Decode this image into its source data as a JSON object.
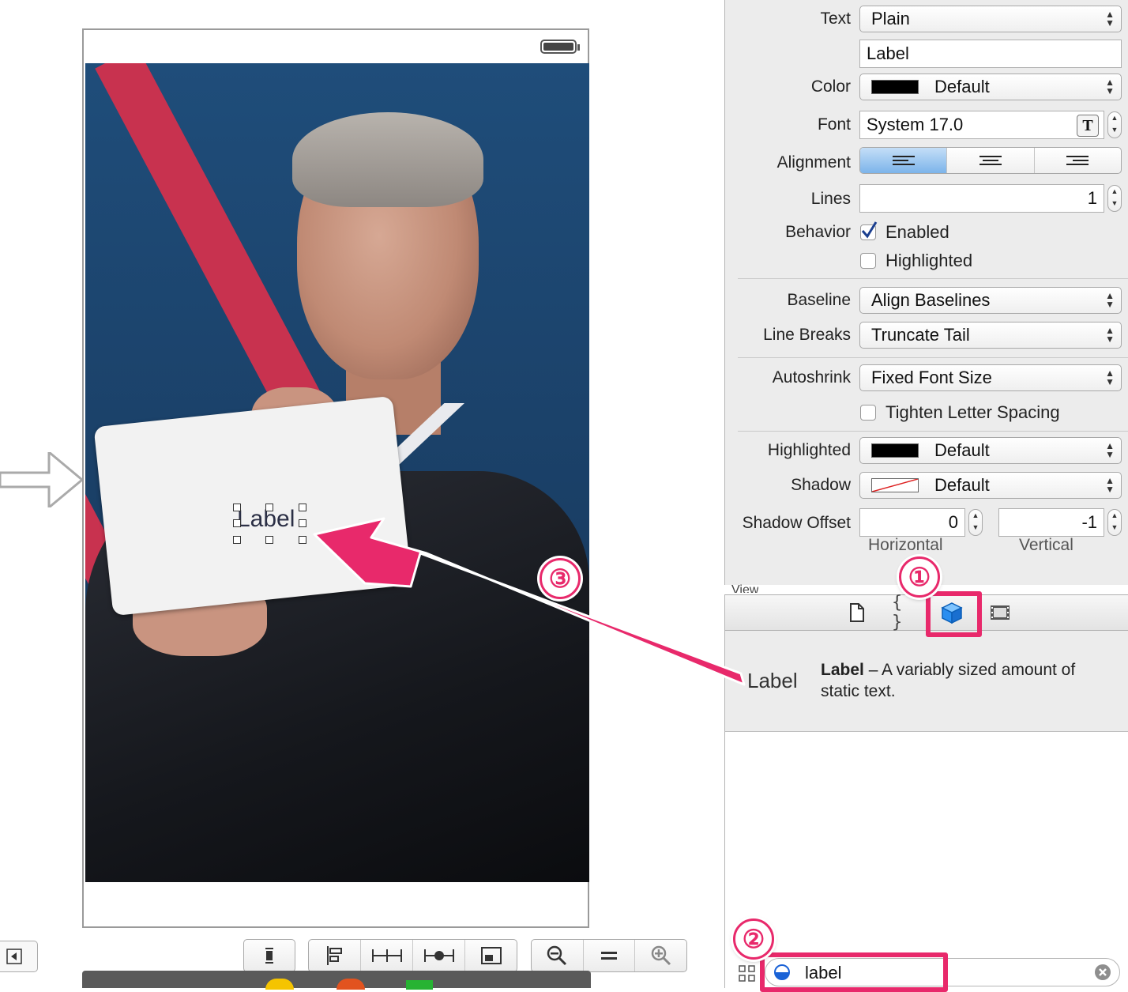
{
  "inspector": {
    "text_label": "Text",
    "text_type": "Plain",
    "text_value": "Label",
    "color_label": "Color",
    "color_value": "Default",
    "font_label": "Font",
    "font_value": "System 17.0",
    "alignment_label": "Alignment",
    "lines_label": "Lines",
    "lines_value": "1",
    "behavior_label": "Behavior",
    "enabled_label": "Enabled",
    "highlighted_check_label": "Highlighted",
    "baseline_label": "Baseline",
    "baseline_value": "Align Baselines",
    "line_breaks_label": "Line Breaks",
    "line_breaks_value": "Truncate Tail",
    "autoshrink_label": "Autoshrink",
    "autoshrink_value": "Fixed Font Size",
    "tighten_label": "Tighten Letter Spacing",
    "highlighted_label": "Highlighted",
    "highlighted_value": "Default",
    "shadow_label": "Shadow",
    "shadow_value": "Default",
    "shadow_offset_label": "Shadow Offset",
    "shadow_offset_h": "0",
    "shadow_offset_v": "-1",
    "horizontal_label": "Horizontal",
    "vertical_label": "Vertical",
    "view_header": "View"
  },
  "library": {
    "item_preview": "Label",
    "item_title": "Label",
    "item_desc": " – A variably sized amount of static text.",
    "filter_value": "label"
  },
  "canvas": {
    "card_label": "Label"
  },
  "annotations": {
    "badge1": "①",
    "badge2": "②",
    "badge3": "③",
    "accent": "#e8296b"
  },
  "icons": [
    "battery-icon",
    "entry-arrow-icon",
    "file-icon",
    "braces-icon",
    "object-cube-icon",
    "media-icon",
    "grid-icon",
    "clear-icon",
    "zoom-out-icon",
    "zoom-in-icon"
  ]
}
